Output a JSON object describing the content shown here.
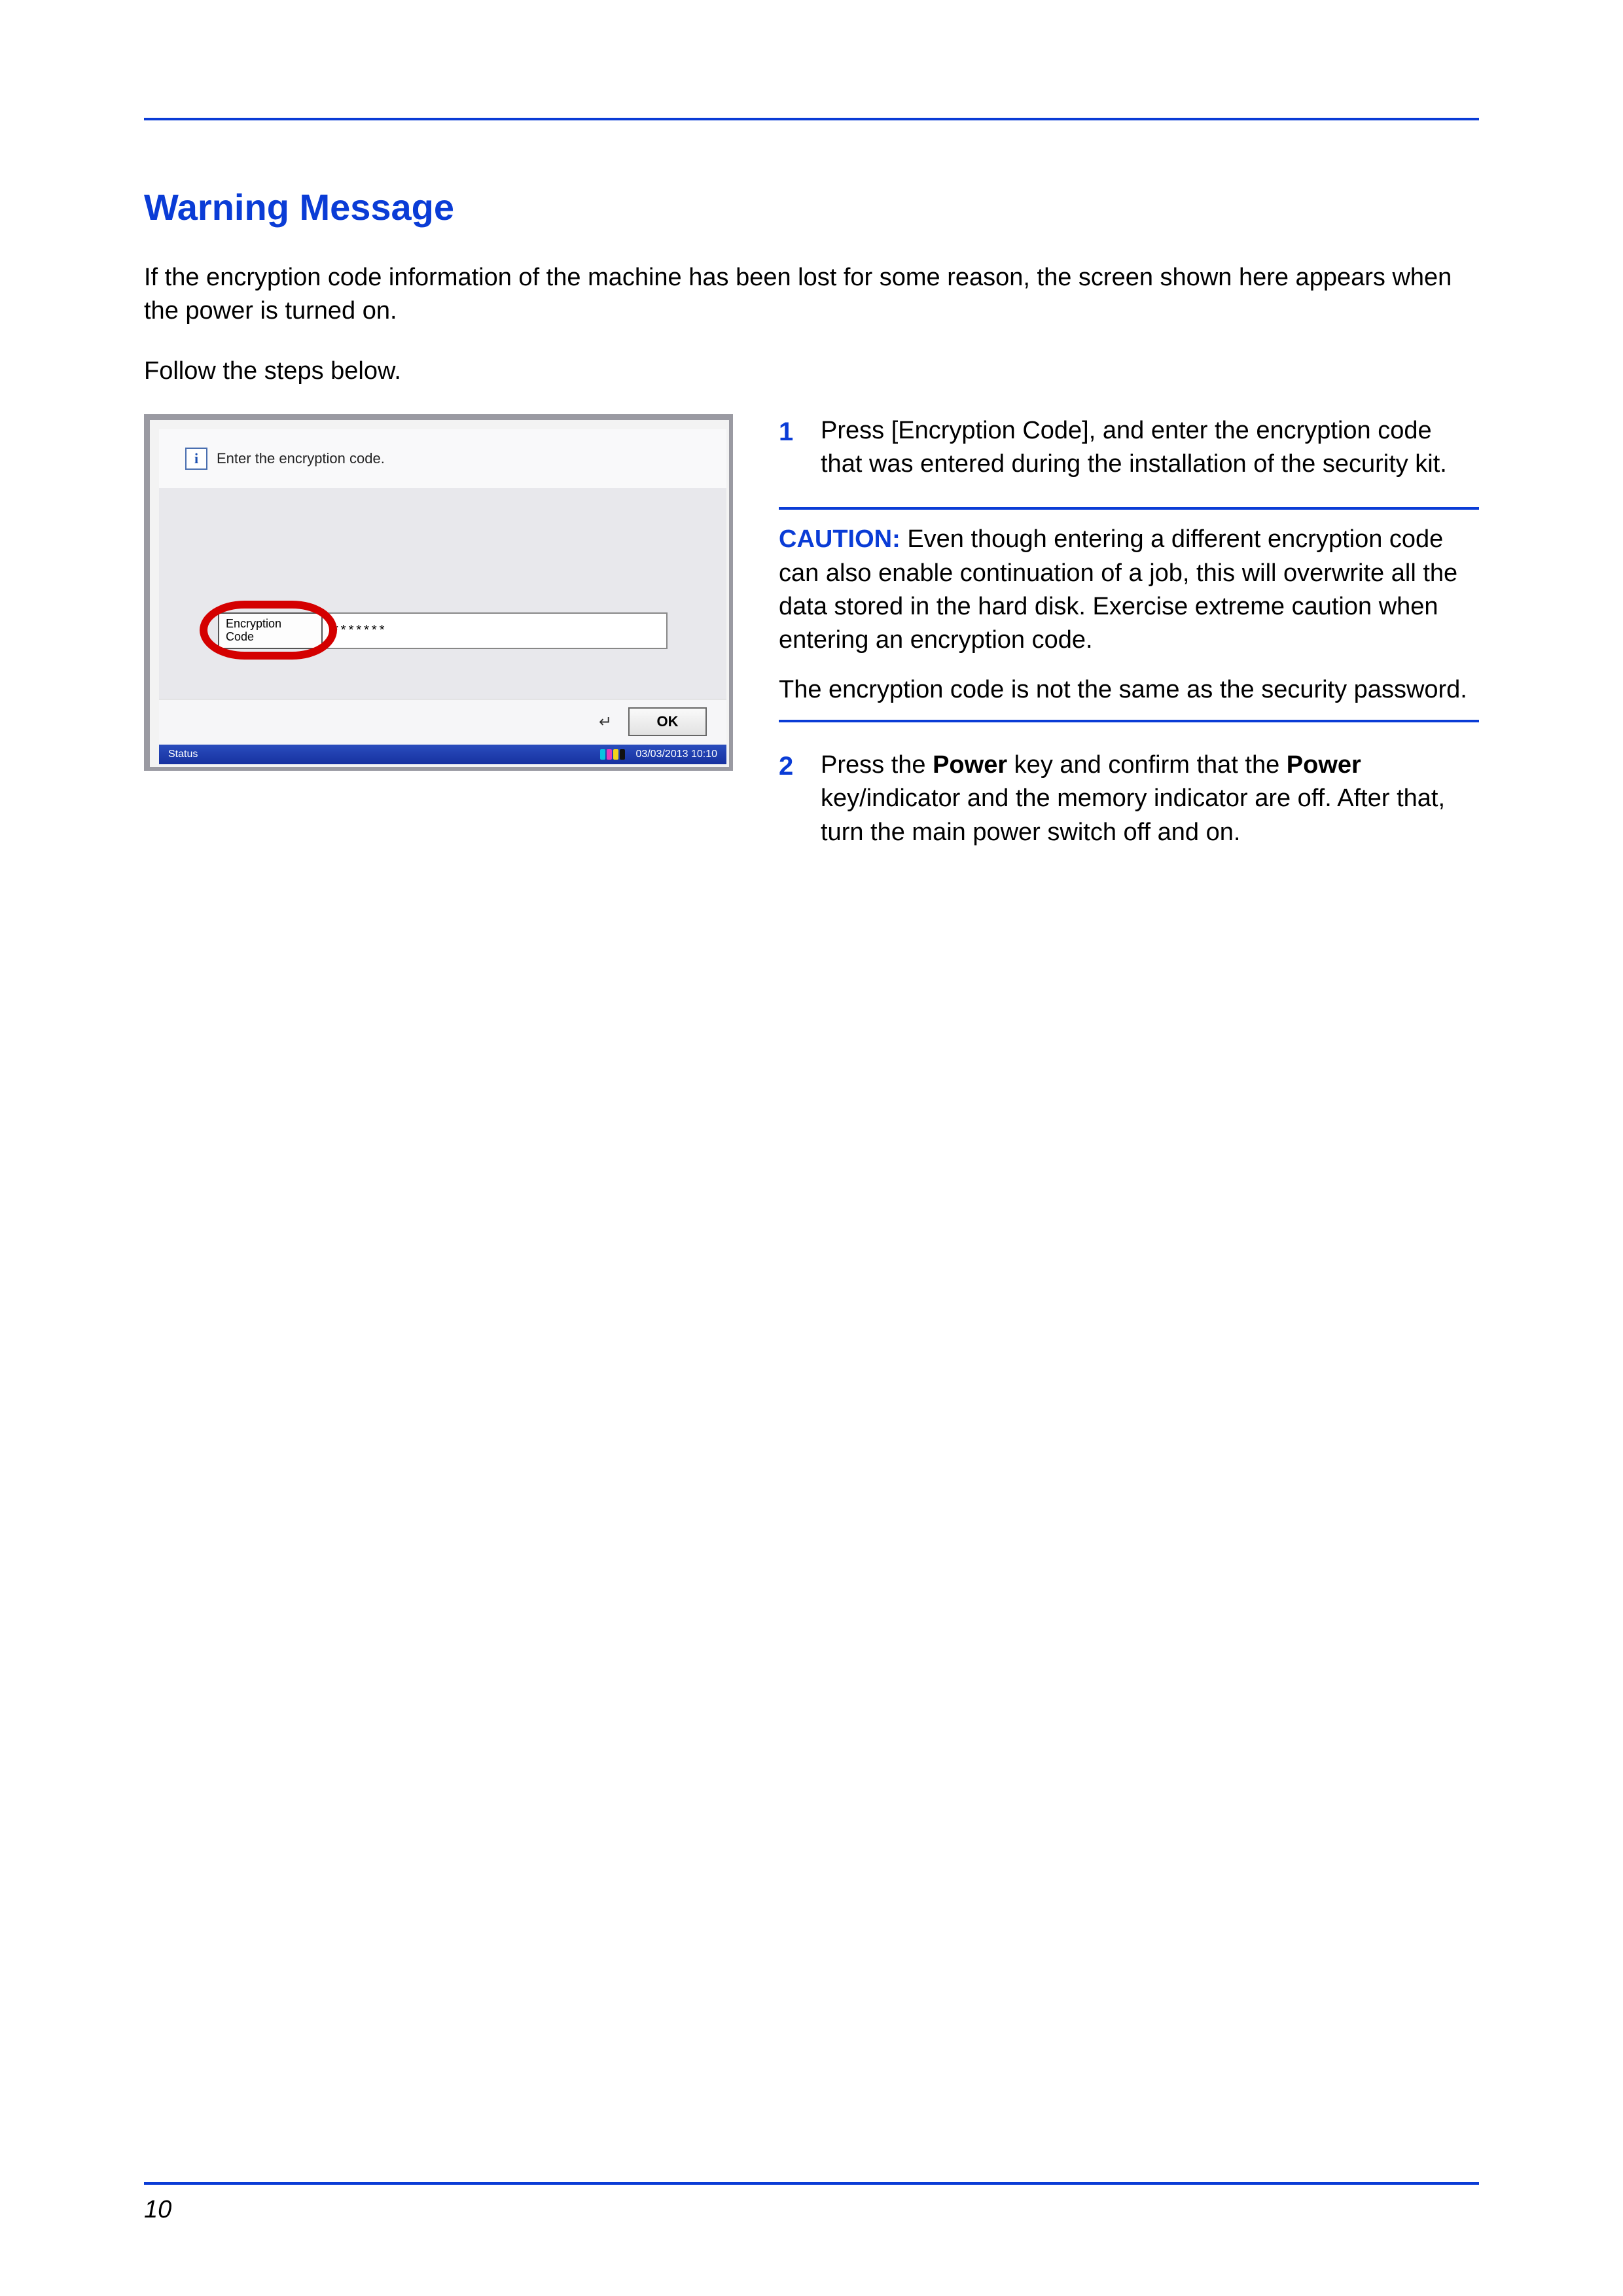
{
  "page": {
    "number": "10"
  },
  "heading": "Warning Message",
  "intro": "If the encryption code information of the machine has been lost for some reason, the screen shown here appears when the power is turned on.",
  "follow": "Follow the steps below.",
  "steps": [
    {
      "num": "1",
      "text": "Press [Encryption Code], and enter the encryption code that was entered during the installation of the security kit."
    },
    {
      "num": "2",
      "before": "Press the ",
      "b1": "Power",
      "mid": " key and confirm that the ",
      "b2": "Power",
      "after": " key/indicator and the memory indicator are off. After that, turn the main power switch off and on."
    }
  ],
  "caution": {
    "label": "CAUTION:",
    "para1": " Even though entering a different encryption code can also enable continuation of a job, this will overwrite all the data stored in the hard disk. Exercise extreme caution when entering an encryption code.",
    "para2": "The encryption code is not the same as the security password."
  },
  "device": {
    "prompt": "Enter the encryption code.",
    "button_label_line1": "Encryption",
    "button_label_line2": "Code",
    "field_value": "*******",
    "ok": "OK",
    "status": "Status",
    "datetime": "03/03/2013  10:10"
  }
}
